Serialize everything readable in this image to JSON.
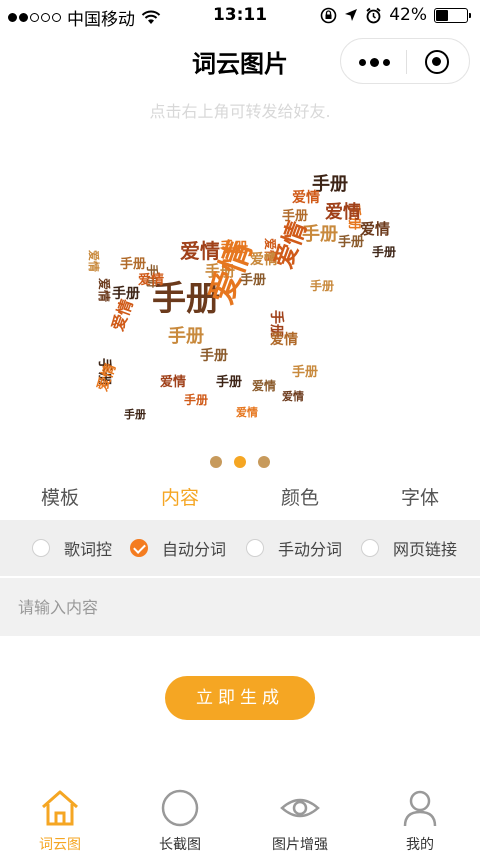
{
  "status_bar": {
    "carrier": "中国移动",
    "time": "13:11",
    "battery_text": "42%",
    "battery_level": 0.42
  },
  "nav": {
    "title": "词云图片"
  },
  "hint": "点击右上角可转发给好友.",
  "cloud": {
    "words": [
      "手册",
      "爱情"
    ],
    "colors": [
      "#a0411a",
      "#6b3a1c",
      "#d05a18",
      "#c8893c",
      "#3d2416",
      "#e6761e",
      "#8a5a2b",
      "#b06a2a"
    ]
  },
  "carousel": {
    "count": 3,
    "active_index": 1
  },
  "tabs": [
    {
      "label": "模板",
      "active": false
    },
    {
      "label": "内容",
      "active": true
    },
    {
      "label": "颜色",
      "active": false
    },
    {
      "label": "字体",
      "active": false
    }
  ],
  "options": [
    {
      "label": "歌词控",
      "checked": false
    },
    {
      "label": "自动分词",
      "checked": true
    },
    {
      "label": "手动分词",
      "checked": false
    },
    {
      "label": "网页链接",
      "checked": false
    }
  ],
  "input": {
    "placeholder": "请输入内容",
    "value": ""
  },
  "generate_button": "立即生成",
  "tabbar": [
    {
      "label": "词云图",
      "icon": "home-icon",
      "active": true
    },
    {
      "label": "长截图",
      "icon": "circle-icon",
      "active": false
    },
    {
      "label": "图片增强",
      "icon": "eye-icon",
      "active": false
    },
    {
      "label": "我的",
      "icon": "user-icon",
      "active": false
    }
  ],
  "colors": {
    "accent": "#f5a623",
    "checked": "#f47c20",
    "indicator": "#c79a5c"
  }
}
